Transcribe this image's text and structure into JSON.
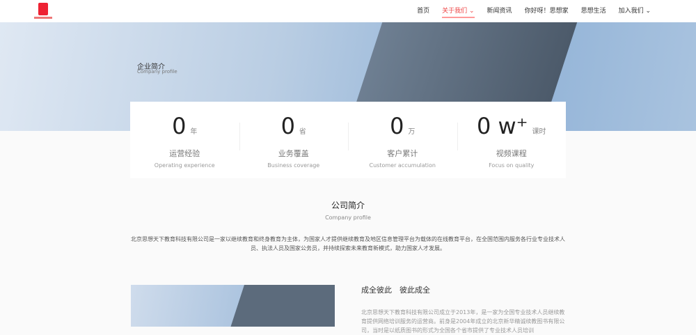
{
  "nav": {
    "items": [
      {
        "label": "首页"
      },
      {
        "label": "关于我们 ⌄"
      },
      {
        "label": "新闻资讯"
      },
      {
        "label": "你好呀！思想家"
      },
      {
        "label": "思想生活"
      },
      {
        "label": "加入我们 ⌄"
      }
    ],
    "active": 1,
    "accent": "#ee4444"
  },
  "hero": {
    "title": "企业简介",
    "subtitle": "Company profile"
  },
  "stats": [
    {
      "value": "0",
      "unit": "年",
      "cn": "运营经验",
      "en": "Operating experience"
    },
    {
      "value": "0",
      "unit": "省",
      "cn": "业务覆盖",
      "en": "Business coverage"
    },
    {
      "value": "0",
      "unit": "万",
      "cn": "客户累计",
      "en": "Customer accumulation"
    },
    {
      "value": "0 w⁺",
      "unit": "课时",
      "cn": "视频课程",
      "en": "Focus on quality"
    }
  ],
  "about": {
    "title": "公司简介",
    "subtitle": "Company profile",
    "desc": "北京思想天下教育科技有限公司是一家以继续教育和终身教育为主体，为国家人才提供继续教育及地区信息管理平台为载体的在线教育平台，在全国范围内服务各行业专业技术人员、执法人员及国家公务员，并持续探索未来教育新模式，助力国家人才发展。"
  },
  "story": {
    "title": "成全彼此　彼此成全",
    "text": "北京思想天下教育科技有限公司成立于2013年，是一家为全国专业技术人员继续教育提供网络培训服务的运营商。前身是2004年成立的北京新华精诚续教图书有限公司，当时是以纸质图书的形式为全国各个省市提供了专业技术人员培训"
  }
}
